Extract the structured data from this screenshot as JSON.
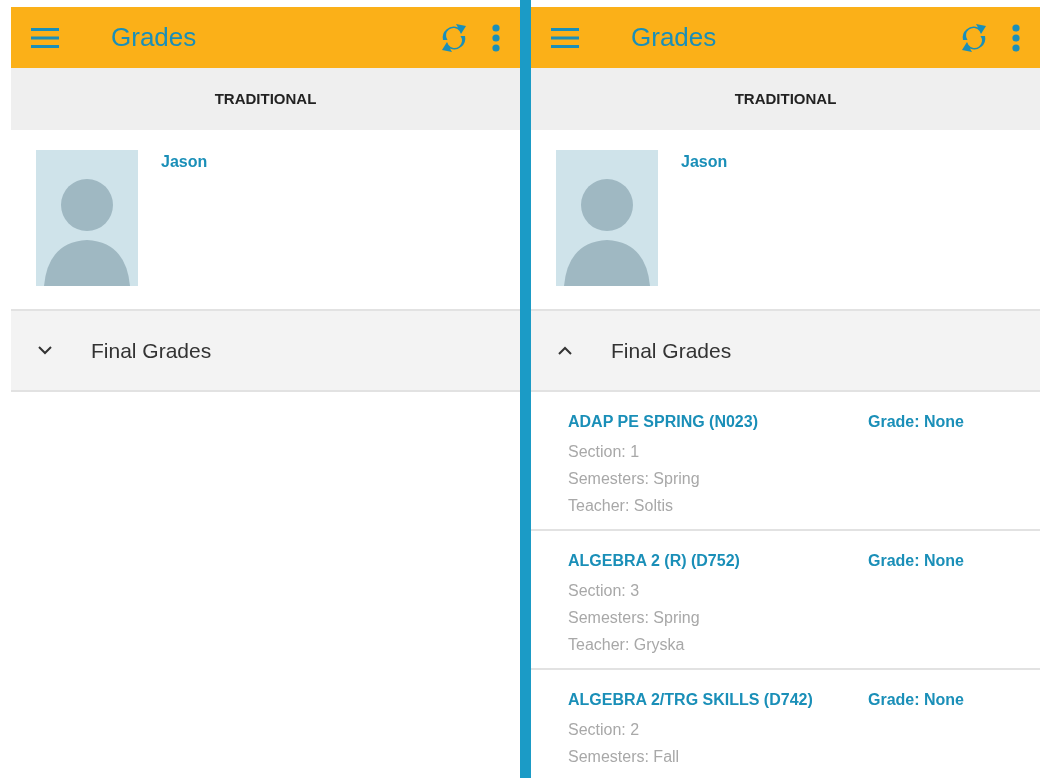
{
  "screens": [
    {
      "title": "Grades",
      "tab": "TRADITIONAL",
      "student": {
        "name": "Jason"
      },
      "section": {
        "title": "Final Grades",
        "expanded": false
      }
    },
    {
      "title": "Grades",
      "tab": "TRADITIONAL",
      "student": {
        "name": "Jason"
      },
      "section": {
        "title": "Final Grades",
        "expanded": true
      },
      "courses": [
        {
          "name": "ADAP PE SPRING (N023)",
          "grade": "Grade: None",
          "details": [
            "Section: 1",
            "Semesters: Spring",
            "Teacher: Soltis"
          ]
        },
        {
          "name": "ALGEBRA 2 (R) (D752)",
          "grade": "Grade: None",
          "details": [
            "Section: 3",
            "Semesters: Spring",
            "Teacher: Gryska"
          ]
        },
        {
          "name": "ALGEBRA 2/TRG SKILLS (D742)",
          "grade": "Grade: None",
          "details": [
            "Section: 2",
            "Semesters: Fall"
          ]
        }
      ]
    }
  ]
}
